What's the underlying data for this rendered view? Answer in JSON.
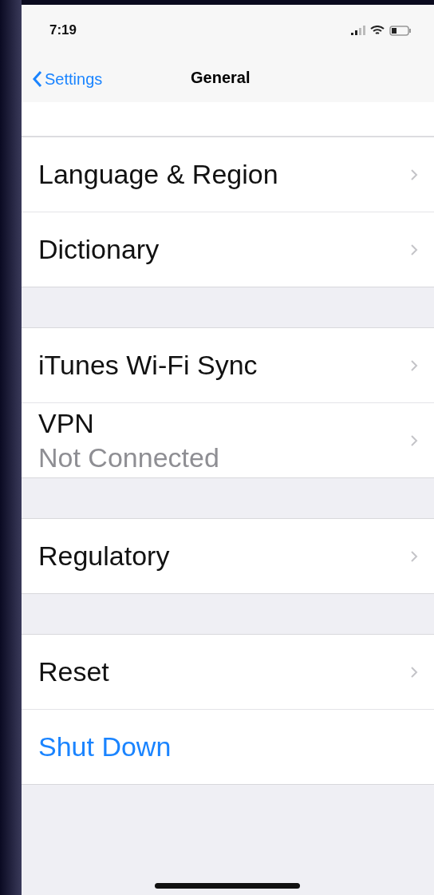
{
  "status_bar": {
    "time": "7:19"
  },
  "nav_bar": {
    "back": "Settings",
    "title": "General"
  },
  "sections": [
    {
      "rows": [
        {
          "kind": "nav",
          "label": "Language & Region"
        },
        {
          "kind": "nav",
          "label": "Dictionary"
        }
      ]
    },
    {
      "rows": [
        {
          "kind": "nav",
          "label": "iTunes Wi-Fi Sync"
        },
        {
          "kind": "nav",
          "label": "VPN",
          "subtitle": "Not Connected"
        }
      ]
    },
    {
      "rows": [
        {
          "kind": "nav",
          "label": "Regulatory"
        }
      ]
    },
    {
      "rows": [
        {
          "kind": "nav",
          "label": "Reset"
        },
        {
          "kind": "action",
          "label": "Shut Down"
        }
      ]
    }
  ]
}
